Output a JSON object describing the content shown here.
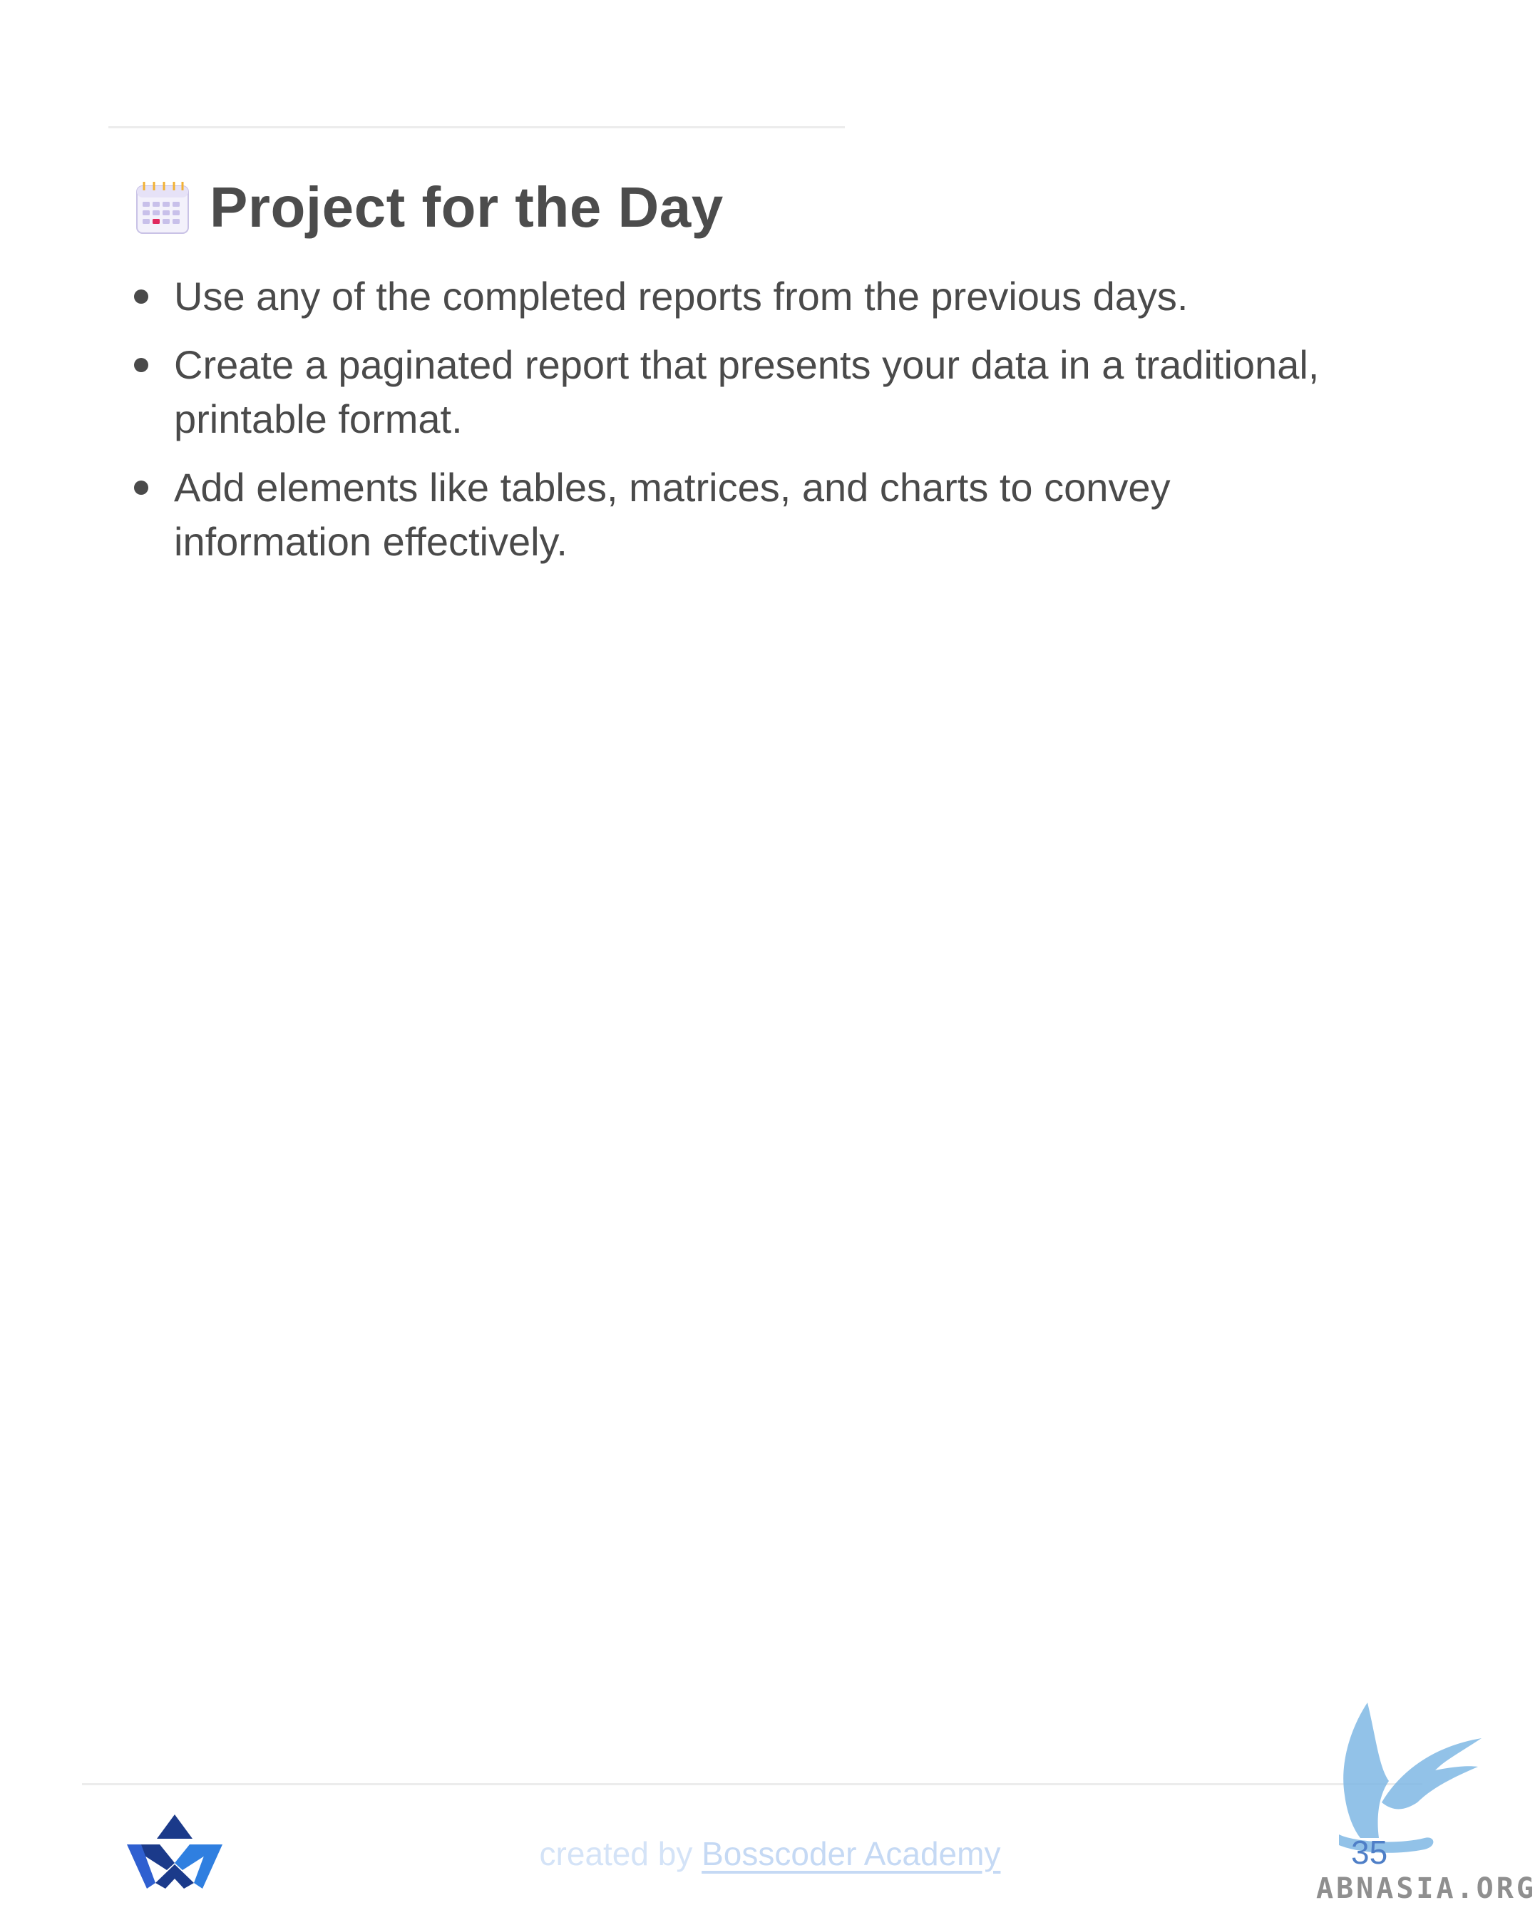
{
  "heading": {
    "icon": "calendar-icon",
    "title": "Project for the Day"
  },
  "bullets": [
    "Use any of the completed reports from the previous days.",
    "Create a paginated report that presents your data in a traditional, printable format.",
    "Add elements like tables, matrices, and charts to convey information effectively."
  ],
  "footer": {
    "prefix": "created by ",
    "link_text": "Bosscoder Academy",
    "page_number": "35",
    "logo": "bosscoder-logo",
    "watermark": "ABNASIA.ORG"
  },
  "colors": {
    "text": "#4a4a4a",
    "footer_text": "#d4e3f7",
    "logo_dark": "#1b3a8a",
    "logo_light": "#2f7fe0",
    "watermark_blue": "#7fb8e4",
    "page_number": "#4f7fc7"
  }
}
